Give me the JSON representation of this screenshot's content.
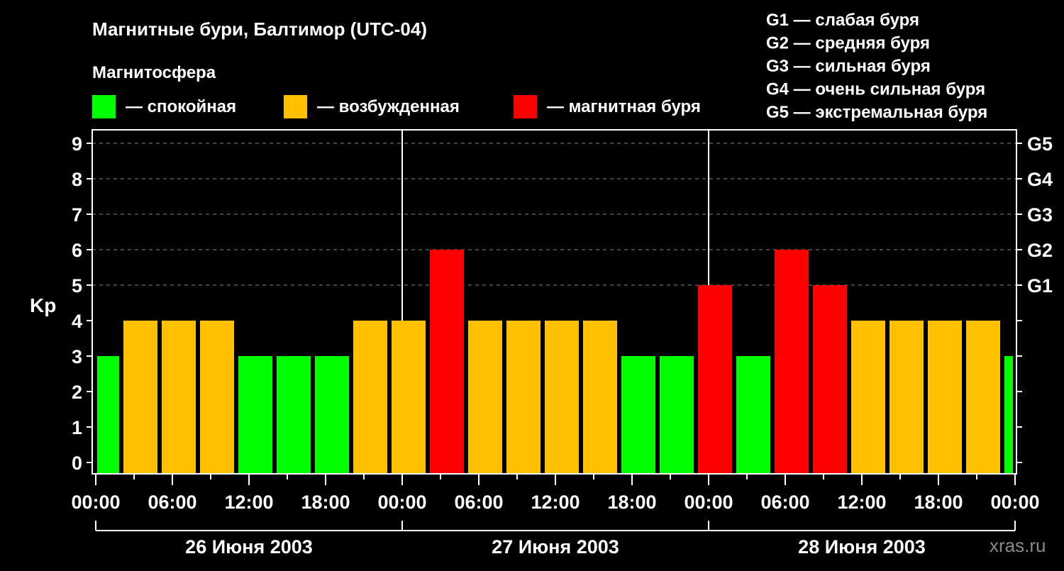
{
  "chart_data": {
    "type": "bar",
    "title": "Магнитные бури, Балтимор (UTC-04)",
    "legend_title": "Магнитосфера",
    "legend": [
      {
        "label": "— спокойная",
        "color": "#00ff00"
      },
      {
        "label": "— возбужденная",
        "color": "#ffc000"
      },
      {
        "label": "— магнитная буря",
        "color": "#ff0000"
      }
    ],
    "g_scale": [
      "G1 — слабая буря",
      "G2 — средняя буря",
      "G3 — сильная буря",
      "G4 — очень сильная буря",
      "G5 — экстремальная буря"
    ],
    "ylabel": "Kp",
    "ylim": [
      0,
      9
    ],
    "yticks": [
      "0",
      "1",
      "2",
      "3",
      "4",
      "5",
      "6",
      "7",
      "8",
      "9"
    ],
    "right_ticks": [
      {
        "kp": 5,
        "label": "G1"
      },
      {
        "kp": 6,
        "label": "G2"
      },
      {
        "kp": 7,
        "label": "G3"
      },
      {
        "kp": 8,
        "label": "G4"
      },
      {
        "kp": 9,
        "label": "G5"
      }
    ],
    "xticks": [
      "00:00",
      "06:00",
      "12:00",
      "18:00",
      "00:00",
      "06:00",
      "12:00",
      "18:00",
      "00:00",
      "06:00",
      "12:00",
      "18:00",
      "00:00"
    ],
    "days": [
      "26 Июня 2003",
      "27 Июня 2003",
      "28 Июня 2003"
    ],
    "bars": [
      {
        "start_h": -1,
        "end_h": 2,
        "kp": 3
      },
      {
        "start_h": 2,
        "end_h": 5,
        "kp": 4
      },
      {
        "start_h": 5,
        "end_h": 8,
        "kp": 4
      },
      {
        "start_h": 8,
        "end_h": 11,
        "kp": 4
      },
      {
        "start_h": 11,
        "end_h": 14,
        "kp": 3
      },
      {
        "start_h": 14,
        "end_h": 17,
        "kp": 3
      },
      {
        "start_h": 17,
        "end_h": 20,
        "kp": 3
      },
      {
        "start_h": 20,
        "end_h": 23,
        "kp": 4
      },
      {
        "start_h": 23,
        "end_h": 26,
        "kp": 4
      },
      {
        "start_h": 26,
        "end_h": 29,
        "kp": 6
      },
      {
        "start_h": 29,
        "end_h": 32,
        "kp": 4
      },
      {
        "start_h": 32,
        "end_h": 35,
        "kp": 4
      },
      {
        "start_h": 35,
        "end_h": 38,
        "kp": 4
      },
      {
        "start_h": 38,
        "end_h": 41,
        "kp": 4
      },
      {
        "start_h": 41,
        "end_h": 44,
        "kp": 3
      },
      {
        "start_h": 44,
        "end_h": 47,
        "kp": 3
      },
      {
        "start_h": 47,
        "end_h": 50,
        "kp": 5
      },
      {
        "start_h": 50,
        "end_h": 53,
        "kp": 3
      },
      {
        "start_h": 53,
        "end_h": 56,
        "kp": 6
      },
      {
        "start_h": 56,
        "end_h": 59,
        "kp": 5
      },
      {
        "start_h": 59,
        "end_h": 62,
        "kp": 4
      },
      {
        "start_h": 62,
        "end_h": 65,
        "kp": 4
      },
      {
        "start_h": 65,
        "end_h": 68,
        "kp": 4
      },
      {
        "start_h": 68,
        "end_h": 71,
        "kp": 4
      },
      {
        "start_h": 71,
        "end_h": 74,
        "kp": 3
      }
    ],
    "watermark": "xras.ru"
  }
}
